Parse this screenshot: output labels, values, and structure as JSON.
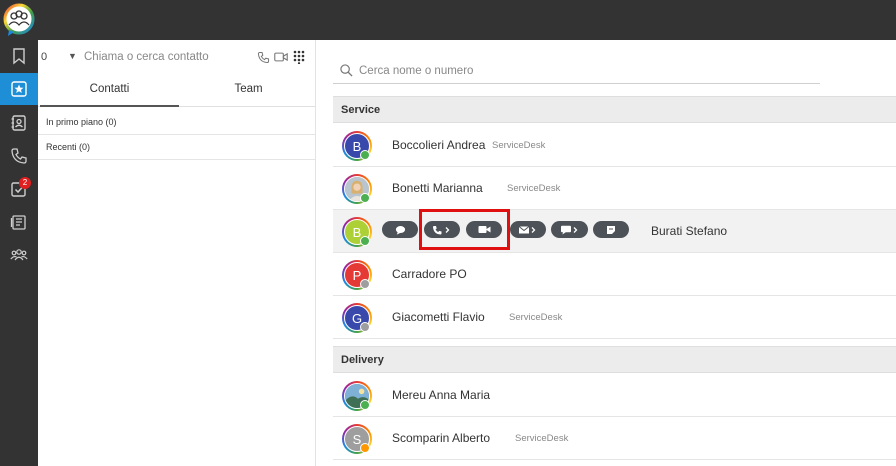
{
  "rail": {
    "items": [
      {
        "icon": "bookmark-icon"
      },
      {
        "icon": "favorites-star-icon",
        "active": true
      },
      {
        "icon": "contacts-book-icon"
      },
      {
        "icon": "phone-icon"
      },
      {
        "icon": "tasks-check-icon",
        "badge": "2"
      },
      {
        "icon": "voicemail-icon"
      },
      {
        "icon": "group-icon"
      }
    ]
  },
  "call": {
    "number": "0",
    "placeholder": "Chiama o cerca contatto"
  },
  "tabs": [
    "Contatti",
    "Team"
  ],
  "sections": {
    "featured": "In primo piano (0)",
    "recent": "Recenti (0)"
  },
  "search": {
    "placeholder": "Cerca nome o numero"
  },
  "groups": [
    {
      "title": "Service",
      "contacts": [
        {
          "name": "Boccolieri Andrea",
          "sub": "ServiceDesk",
          "initial": "B",
          "color": "#3949ab",
          "status": "#4caf50"
        },
        {
          "name": "Bonetti Marianna",
          "sub": "ServiceDesk",
          "initial": "",
          "color": "#8d9aa6",
          "status": "#4caf50"
        },
        {
          "name": "Burati Stefano",
          "sub": "",
          "initial": "B",
          "color": "#aed037",
          "status": "#4caf50"
        },
        {
          "name": "Carradore PO",
          "sub": "",
          "initial": "P",
          "color": "#e53935",
          "status": "#9e9e9e"
        },
        {
          "name": "Giacometti Flavio",
          "sub": "ServiceDesk",
          "initial": "G",
          "color": "#3949ab",
          "status": "#9e9e9e"
        }
      ]
    },
    {
      "title": "Delivery",
      "contacts": [
        {
          "name": "Mereu Anna Maria",
          "sub": "",
          "initial": "",
          "color": "#4f7fa3",
          "status": "#4caf50"
        },
        {
          "name": "Scomparin Alberto",
          "sub": "ServiceDesk",
          "initial": "S",
          "color": "#9e9e9e",
          "status": "#ff9800"
        }
      ]
    }
  ],
  "actions": [
    "chat-icon",
    "phone-call-icon",
    "video-call-icon",
    "email-icon",
    "sms-icon",
    "note-icon"
  ],
  "colors": {
    "rail": "#333333",
    "active": "#1e8fd6",
    "highlight": "#e01010",
    "badge": "#e02020"
  }
}
